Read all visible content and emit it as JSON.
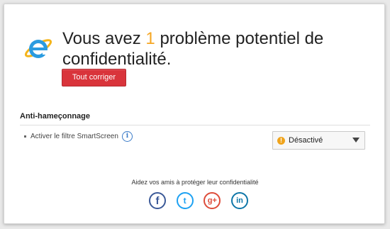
{
  "header": {
    "headline_before": "Vous avez ",
    "problem_count": "1",
    "headline_after": " problème potentiel de confidentialité.",
    "fix_button_label": "Tout corriger"
  },
  "section": {
    "title": "Anti-hameçonnage",
    "setting_label": "Activer le filtre SmartScreen",
    "info_icon_glyph": "i",
    "status_value": "Désactivé",
    "warn_icon_glyph": "!"
  },
  "share": {
    "text": "Aidez vos amis à protéger leur confidentialité",
    "networks": [
      {
        "name": "facebook",
        "glyph": "f"
      },
      {
        "name": "twitter",
        "glyph": "t"
      },
      {
        "name": "google-plus",
        "glyph": "g+"
      },
      {
        "name": "linkedin",
        "glyph": "in"
      }
    ]
  },
  "colors": {
    "accent_count": "#f5a623",
    "fix_button": "#d9343b",
    "warning": "#f0a41c",
    "facebook": "#3b5998",
    "twitter": "#1da1f2",
    "google_plus": "#dd4b39",
    "linkedin": "#0e76a8"
  },
  "icons": {
    "logo": "internet-explorer-logo"
  }
}
